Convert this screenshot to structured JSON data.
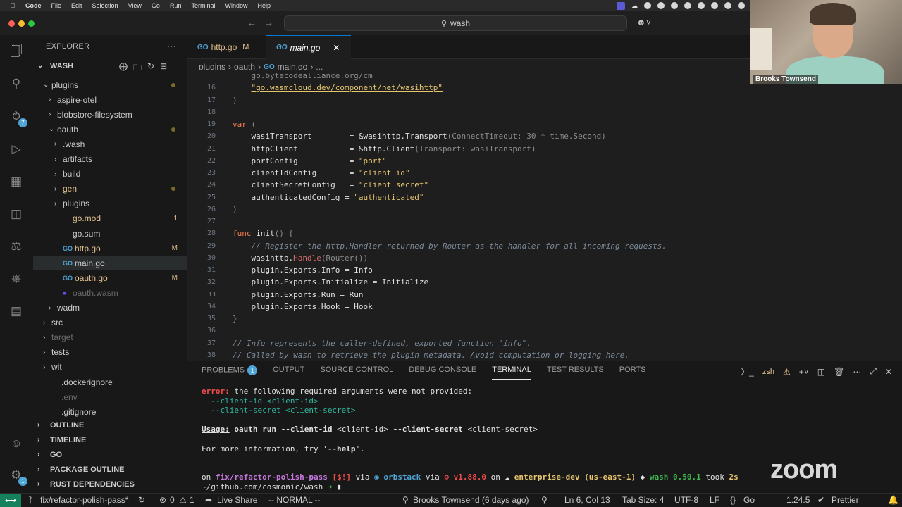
{
  "menubar": {
    "app": "Code",
    "items": [
      "File",
      "Edit",
      "Selection",
      "View",
      "Go",
      "Run",
      "Terminal",
      "Window",
      "Help"
    ]
  },
  "titlebar": {
    "search": "wash"
  },
  "webcam": {
    "name": "Brooks Townsend"
  },
  "sidebar": {
    "title": "EXPLORER",
    "root": "WASH",
    "tree": [
      {
        "label": "plugins",
        "indent": 1,
        "kind": "folder-open",
        "deco": "dot"
      },
      {
        "label": "aspire-otel",
        "indent": 2,
        "kind": "folder"
      },
      {
        "label": "blobstore-filesystem",
        "indent": 2,
        "kind": "folder"
      },
      {
        "label": "oauth",
        "indent": 2,
        "kind": "folder-open",
        "deco": "dot"
      },
      {
        "label": ".wash",
        "indent": 3,
        "kind": "folder"
      },
      {
        "label": "artifacts",
        "indent": 3,
        "kind": "folder"
      },
      {
        "label": "build",
        "indent": 3,
        "kind": "folder"
      },
      {
        "label": "gen",
        "indent": 3,
        "kind": "folder",
        "color": "#e2c08d",
        "deco": "dot"
      },
      {
        "label": "plugins",
        "indent": 3,
        "kind": "folder"
      },
      {
        "label": "go.mod",
        "indent": 3,
        "kind": "file",
        "color": "#e2c08d",
        "deco": "1"
      },
      {
        "label": "go.sum",
        "indent": 3,
        "kind": "file"
      },
      {
        "label": "http.go",
        "indent": 3,
        "kind": "file",
        "color": "#e2c08d",
        "deco": "M"
      },
      {
        "label": "main.go",
        "indent": 3,
        "kind": "file",
        "selected": true
      },
      {
        "label": "oauth.go",
        "indent": 3,
        "kind": "file",
        "color": "#e2c08d",
        "deco": "M"
      },
      {
        "label": "oauth.wasm",
        "indent": 3,
        "kind": "file",
        "color": "#6a6a6a"
      },
      {
        "label": "wadm",
        "indent": 2,
        "kind": "folder"
      },
      {
        "label": "src",
        "indent": 1,
        "kind": "folder"
      },
      {
        "label": "target",
        "indent": 1,
        "kind": "folder",
        "color": "#6a6a6a"
      },
      {
        "label": "tests",
        "indent": 1,
        "kind": "folder"
      },
      {
        "label": "wit",
        "indent": 1,
        "kind": "folder"
      },
      {
        "label": ".dockerignore",
        "indent": 1,
        "kind": "file"
      },
      {
        "label": ".env",
        "indent": 1,
        "kind": "file",
        "color": "#6a6a6a"
      },
      {
        "label": ".gitignore",
        "indent": 1,
        "kind": "file"
      }
    ],
    "sections": [
      "OUTLINE",
      "TIMELINE",
      "GO",
      "PACKAGE OUTLINE",
      "RUST DEPENDENCIES"
    ]
  },
  "tabs": [
    {
      "label": "http.go",
      "badge": "M"
    },
    {
      "label": "main.go",
      "active": true
    }
  ],
  "breadcrumb": [
    "plugins",
    "oauth",
    "main.go",
    "..."
  ],
  "code": {
    "lines": [
      {
        "n": "",
        "html": "<span class='g'>    go.bytecodealliance.org/cm</span>"
      },
      {
        "n": "16",
        "html": "    <span class='u'>\"go.wasmcloud.dev/component/net/wasihttp\"</span>"
      },
      {
        "n": "17",
        "html": "<span class='g'>)</span>"
      },
      {
        "n": "18",
        "html": ""
      },
      {
        "n": "19",
        "html": "<span class='k'>var</span> <span class='g'>(</span>"
      },
      {
        "n": "20",
        "html": "    <span class='t'>wasiTransport        = &amp;wasihttp.Transport</span><span class='g'>(ConnectTimeout: 30 * time.Second)</span>"
      },
      {
        "n": "21",
        "html": "    <span class='t'>httpClient           = &amp;http.Client</span><span class='g'>(Transport: wasiTransport)</span>"
      },
      {
        "n": "22",
        "html": "    <span class='t'>portConfig           = </span><span class='s'>\"port\"</span>"
      },
      {
        "n": "23",
        "html": "    <span class='t'>clientIdConfig       = </span><span class='s'>\"client_id\"</span>"
      },
      {
        "n": "24",
        "html": "    <span class='t'>clientSecretConfig   = </span><span class='s'>\"client_secret\"</span>"
      },
      {
        "n": "25",
        "html": "    <span class='t'>authenticatedConfig = </span><span class='s'>\"authenticated\"</span>"
      },
      {
        "n": "26",
        "html": "<span class='g'>)</span>"
      },
      {
        "n": "27",
        "html": ""
      },
      {
        "n": "28",
        "html": "<span class='k'>func</span> <span class='t'>init</span><span class='g'>() {</span>"
      },
      {
        "n": "29",
        "html": "    <span class='c'>// Register the http.Handler returned by Router as the handler for all incoming requests.</span>"
      },
      {
        "n": "30",
        "html": "    <span class='t'>wasihttp.</span><span class='f'>Handle</span><span class='g'>(Router())</span>"
      },
      {
        "n": "31",
        "html": "    <span class='t'>plugin.Exports.Info = Info</span>"
      },
      {
        "n": "32",
        "html": "    <span class='t'>plugin.Exports.Initialize = Initialize</span>"
      },
      {
        "n": "33",
        "html": "    <span class='t'>plugin.Exports.Run = Run</span>"
      },
      {
        "n": "34",
        "html": "    <span class='t'>plugin.Exports.Hook = Hook</span>"
      },
      {
        "n": "35",
        "html": "<span class='g'>}</span>"
      },
      {
        "n": "36",
        "html": ""
      },
      {
        "n": "37",
        "html": "<span class='c'>// Info represents the caller-defined, exported function \"info\".</span>"
      },
      {
        "n": "38",
        "html": "<span class='c'>// Called by wash to retrieve the plugin metadata. Avoid computation or logging here.</span>"
      }
    ]
  },
  "panel": {
    "tabs": [
      {
        "label": "PROBLEMS",
        "badge": "1"
      },
      {
        "label": "OUTPUT"
      },
      {
        "label": "SOURCE CONTROL"
      },
      {
        "label": "DEBUG CONSOLE"
      },
      {
        "label": "TERMINAL",
        "active": true
      },
      {
        "label": "TEST RESULTS"
      },
      {
        "label": "PORTS"
      }
    ],
    "shell": "zsh",
    "terminal": [
      {
        "html": "<span style='color:#f14c4c;font-weight:bold'>error:</span> <span style='color:#e0e0e0'>the following required arguments were not provided:</span>"
      },
      {
        "html": "  <span style='color:#2fb8a0'>--client-id &lt;client-id&gt;</span>"
      },
      {
        "html": "  <span style='color:#2fb8a0'>--client-secret &lt;client-secret&gt;</span>"
      },
      {
        "html": ""
      },
      {
        "html": "<span style='color:#e0e0e0;font-weight:bold;text-decoration:underline'>Usage:</span> <span style='color:#e0e0e0;font-weight:bold'>oauth run --client-id</span> <span style='color:#e0e0e0'>&lt;client-id&gt;</span> <span style='color:#e0e0e0;font-weight:bold'>--client-secret</span> <span style='color:#e0e0e0'>&lt;client-secret&gt;</span>"
      },
      {
        "html": ""
      },
      {
        "html": "<span style='color:#e0e0e0'>For more information, try '</span><span style='color:#e0e0e0;font-weight:bold'>--help</span><span style='color:#e0e0e0'>'.</span>"
      },
      {
        "html": ""
      },
      {
        "html": ""
      },
      {
        "html": "<span style='color:#e0e0e0'>on </span><span style='color:#c678dd;font-weight:bold'>fix/refactor-polish-pass</span> <span style='color:#f14c4c;font-weight:bold'>[$!]</span><span style='color:#e0e0e0'> via </span><span style='color:#4ea5d6;font-weight:bold'>&#9673; orbstack</span><span style='color:#e0e0e0'> via </span><span style='color:#f14c4c;font-weight:bold'>&#9881; v1.88.0</span><span style='color:#e0e0e0'> on </span><span style='color:#e0e0e0;font-weight:bold'>&#9729; </span><span style='color:#e6c56d;font-weight:bold'>enterprise-dev (us-east-1)</span><span style='color:#e0e0e0'> &#9670; </span><span style='color:#3fb950;font-weight:bold'>wash 0.50.1</span><span style='color:#e0e0e0'> took </span><span style='color:#e6c56d;font-weight:bold'>2s</span>"
      },
      {
        "html": "<span style='color:#e0e0e0'>~/github.com/cosmonic/wash</span> <span style='color:#3fb950;font-weight:bold'>&#10140;</span> <span style='color:#e0e0e0'>&#9646;</span>"
      }
    ]
  },
  "statusbar": {
    "branch": "fix/refactor-polish-pass*",
    "errors": "0",
    "warnings": "1",
    "liveshare": "Live Share",
    "mode": "-- NORMAL --",
    "blame": "Brooks Townsend (6 days ago)",
    "position": "Ln 6, Col 13",
    "tabsize": "Tab Size: 4",
    "encoding": "UTF-8",
    "eol": "LF",
    "language": "Go",
    "goversion": "1.24.5",
    "formatter": "Prettier"
  },
  "overlay": {
    "zoom": "zoom"
  }
}
